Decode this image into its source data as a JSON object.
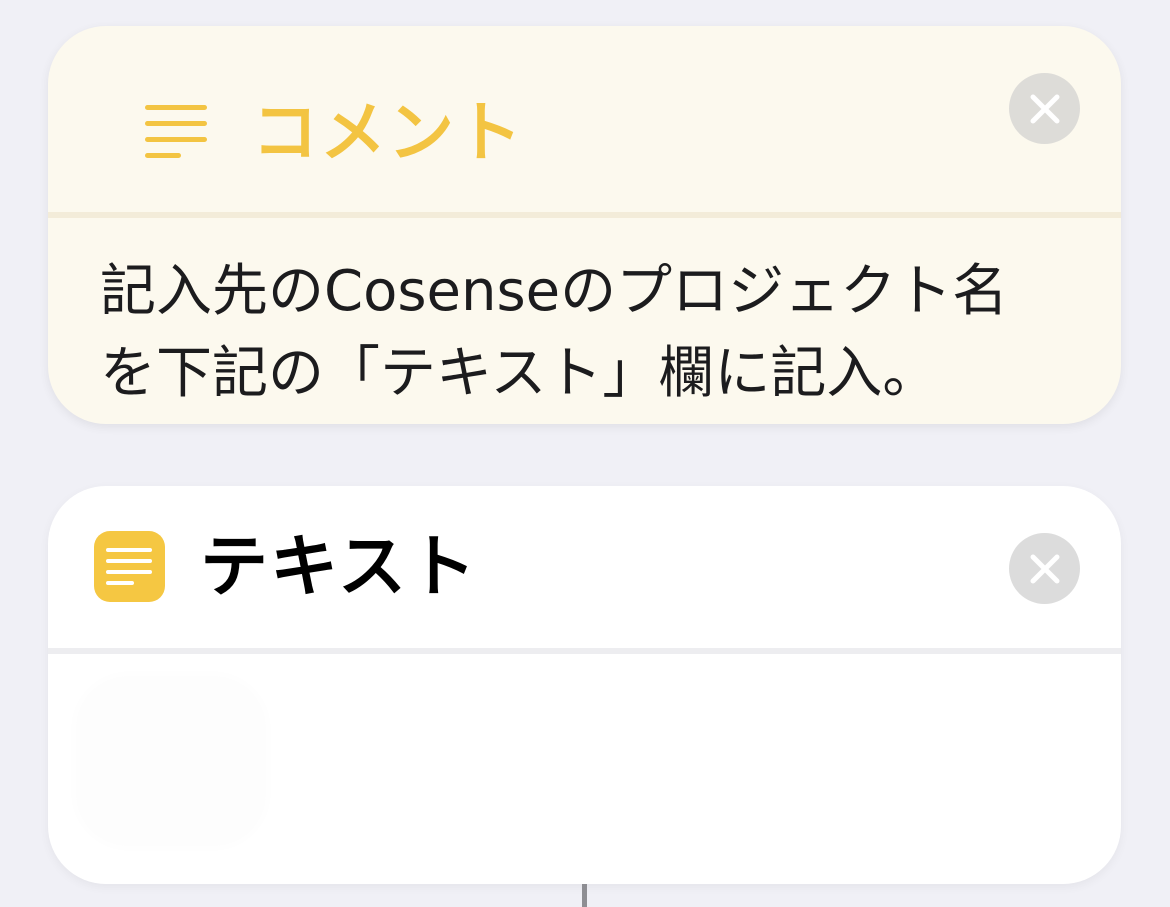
{
  "comment_card": {
    "icon": "text-lines-icon",
    "title": "コメント",
    "body": "記入先のCosenseのプロジェクト名\nを下記の「テキスト」欄に記入。",
    "close_icon": "close-icon",
    "accent_color": "#f3c442",
    "background_color": "#fcf9ee"
  },
  "text_card": {
    "icon": "text-document-icon",
    "title": "テキスト",
    "close_icon": "close-icon",
    "input_value": "",
    "icon_color": "#f5c742"
  }
}
